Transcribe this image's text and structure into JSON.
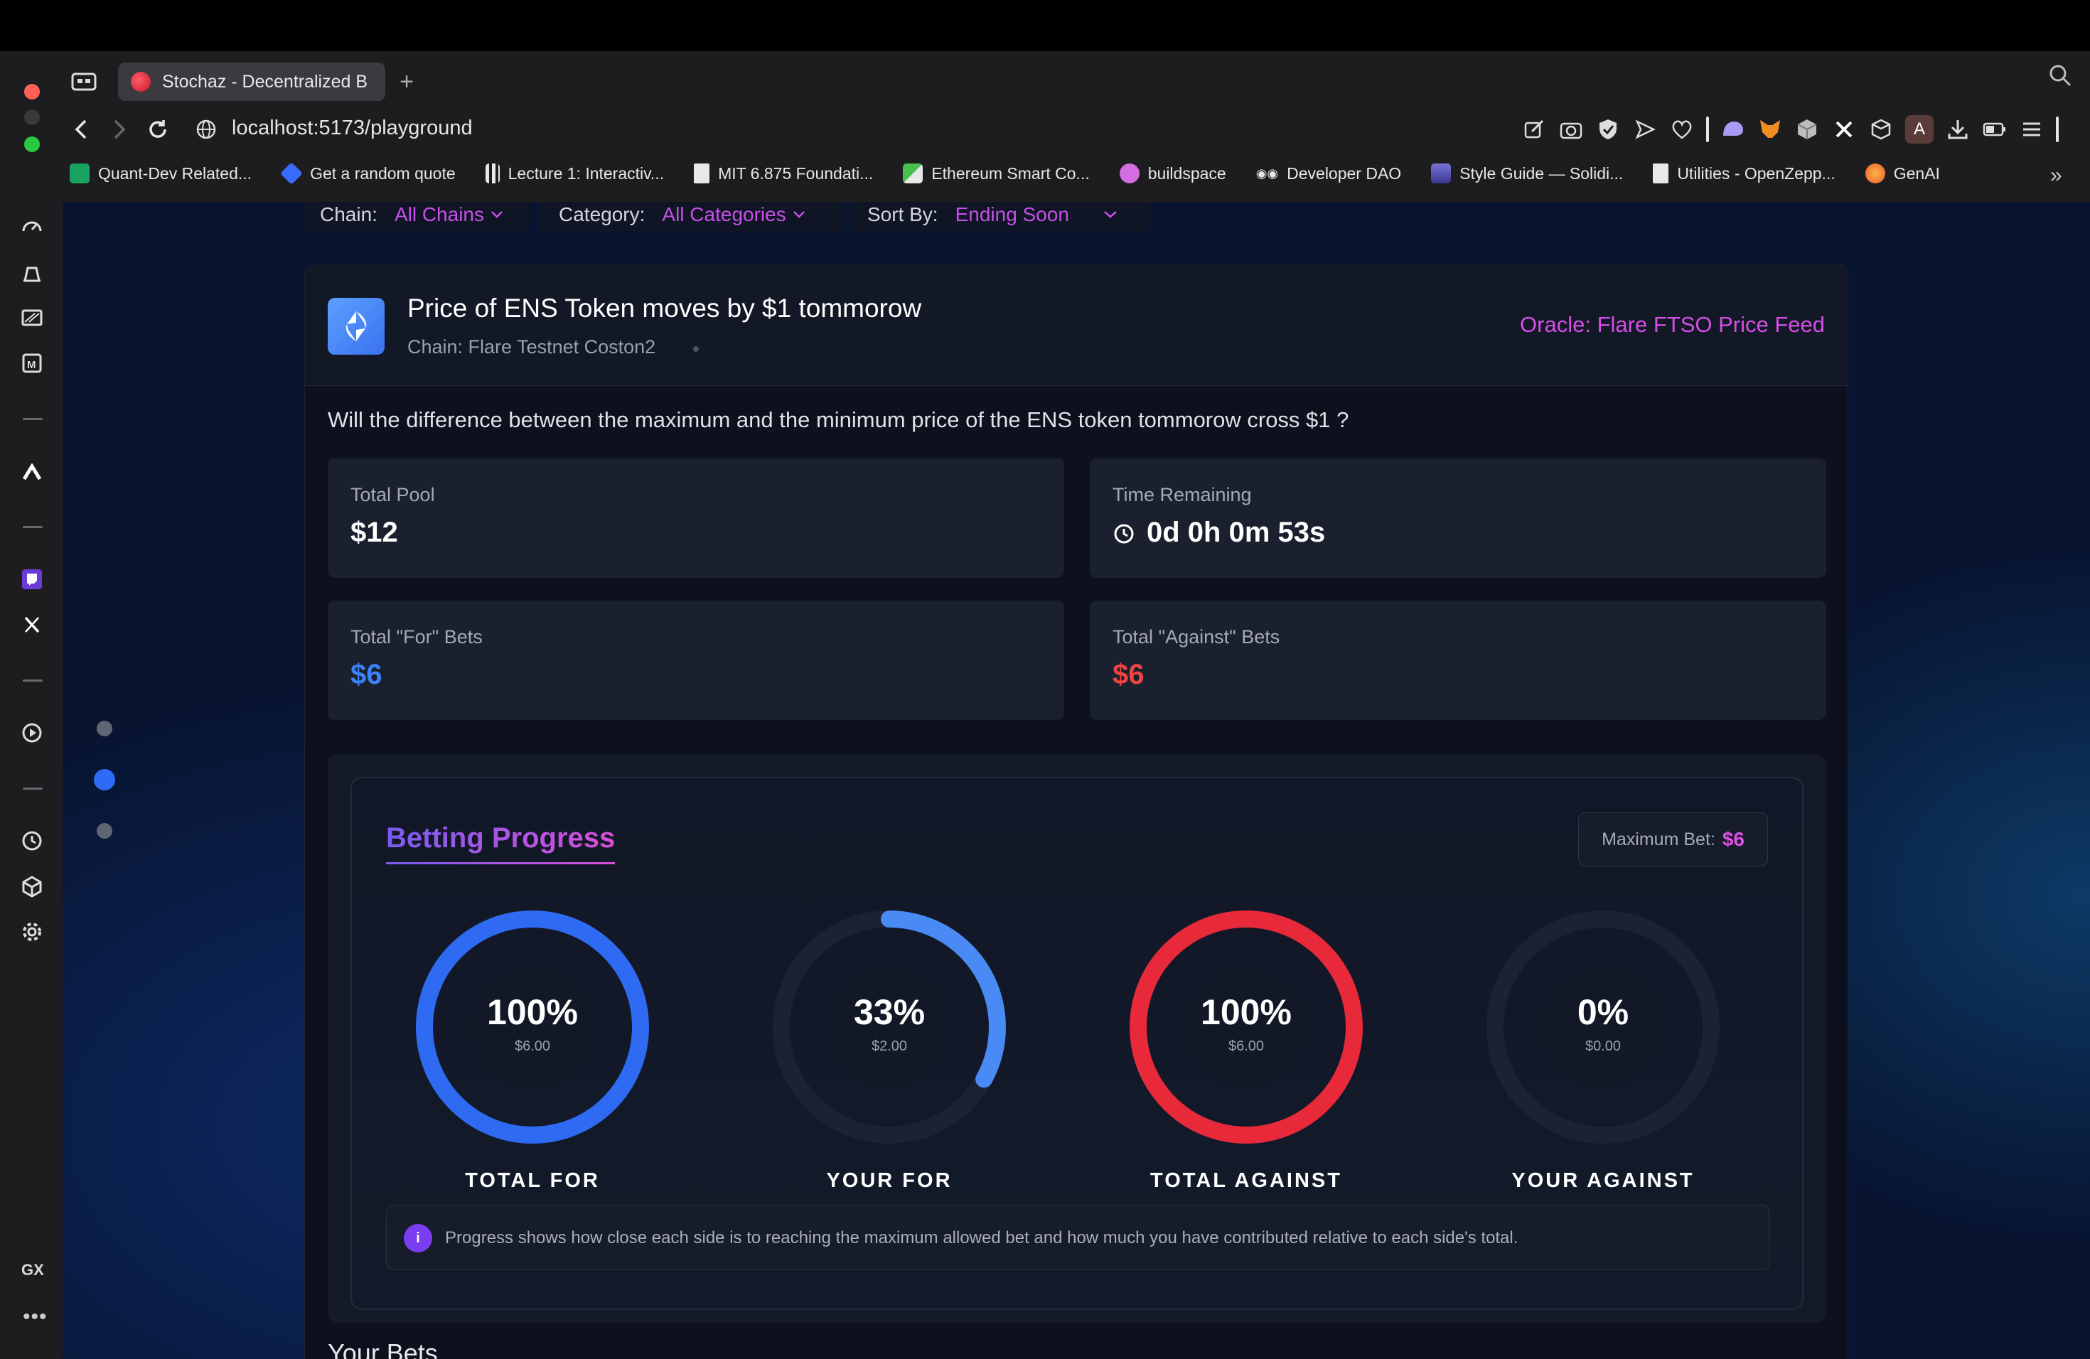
{
  "browser": {
    "tab_title": "Stochaz - Decentralized B",
    "url": "localhost:5173/playground",
    "bookmarks": [
      {
        "label": "Quant-Dev Related...",
        "icon": "sheet-icon",
        "color": "#1aa260"
      },
      {
        "label": "Get a random quote",
        "icon": "diamond-icon",
        "color": "#3a6bff"
      },
      {
        "label": "Lecture 1: Interactiv...",
        "icon": "bars-icon",
        "color": "#e8e8ea"
      },
      {
        "label": "MIT 6.875 Foundati...",
        "icon": "doc-icon",
        "color": "#e8e8ea"
      },
      {
        "label": "Ethereum Smart Co...",
        "icon": "frame-icon",
        "color": "#49c04b"
      },
      {
        "label": "buildspace",
        "icon": "unicorn-icon",
        "color": "#d36de0"
      },
      {
        "label": "Developer DAO",
        "icon": "glasses-icon",
        "color": "#e8e8ea"
      },
      {
        "label": "Style Guide — Solidi...",
        "icon": "solidity-icon",
        "color": "#7a74d6"
      },
      {
        "label": "Utilities - OpenZepp...",
        "icon": "doc-icon",
        "color": "#e8e8ea"
      },
      {
        "label": "GenAI",
        "icon": "genai-icon",
        "color": "#e85d2a"
      }
    ],
    "gx_label": "GX",
    "new_tab_symbol": "+",
    "more_bookmarks_symbol": "»",
    "avatar_letter": "A",
    "more_symbol": "•••"
  },
  "filters": {
    "chain_label": "Chain:",
    "chain_value": "All Chains",
    "category_label": "Category:",
    "category_value": "All Categories",
    "sort_label": "Sort By:",
    "sort_value": "Ending Soon"
  },
  "market": {
    "title": "Price of ENS Token moves by $1 tommorow",
    "chain": "Chain: Flare Testnet Coston2",
    "oracle": "Oracle: Flare FTSO Price Feed",
    "question": "Will the difference between the maximum and the minimum price of the ENS token tommorow cross $1 ?",
    "stats": {
      "total_pool_label": "Total Pool",
      "total_pool_value": "$12",
      "time_remaining_label": "Time Remaining",
      "time_remaining_value": "0d 0h 0m 53s",
      "for_label": "Total \"For\" Bets",
      "for_value": "$6",
      "against_label": "Total \"Against\" Bets",
      "against_value": "$6"
    }
  },
  "progress": {
    "title": "Betting Progress",
    "max_bet_label": "Maximum Bet:",
    "max_bet_value": "$6",
    "rings": [
      {
        "label": "TOTAL FOR",
        "percent_text": "100%",
        "amount": "$6.00",
        "fraction": 1.0,
        "color": "#2f6bf2"
      },
      {
        "label": "YOUR FOR",
        "percent_text": "33%",
        "amount": "$2.00",
        "fraction": 0.33,
        "color": "#4a8af4"
      },
      {
        "label": "TOTAL AGAINST",
        "percent_text": "100%",
        "amount": "$6.00",
        "fraction": 1.0,
        "color": "#e8293a"
      },
      {
        "label": "YOUR AGAINST",
        "percent_text": "0%",
        "amount": "$0.00",
        "fraction": 0.0,
        "color": "#e8293a"
      }
    ],
    "info_icon": "i",
    "info": "Progress shows how close each side is to reaching the maximum allowed bet and how much you have contributed relative to each side's total."
  },
  "colors": {
    "for": "#3b82f6",
    "against": "#ef4444",
    "accent": "#d64fe6"
  }
}
